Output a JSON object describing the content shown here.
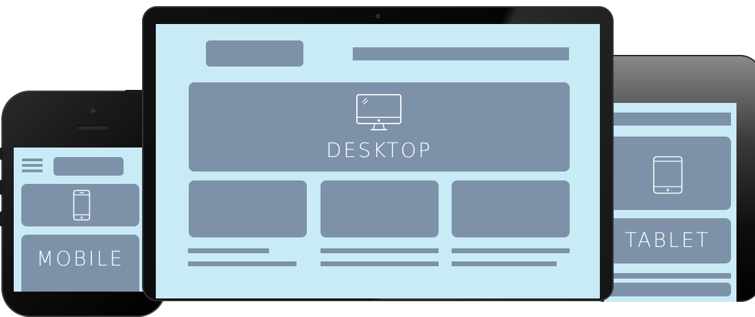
{
  "devices": {
    "desktop": {
      "label": "DESKTOP",
      "icon": "desktop-monitor-icon"
    },
    "tablet": {
      "label": "TABLET",
      "icon": "tablet-icon"
    },
    "mobile": {
      "label": "MOBILE",
      "icon": "smartphone-icon",
      "menu_icon": "hamburger-menu-icon"
    }
  },
  "colors": {
    "screen_background": "#c9ebf6",
    "wireframe_block": "#7d91a9",
    "device_bezel": "#0b0b0b",
    "label_text": "#ffffff"
  }
}
